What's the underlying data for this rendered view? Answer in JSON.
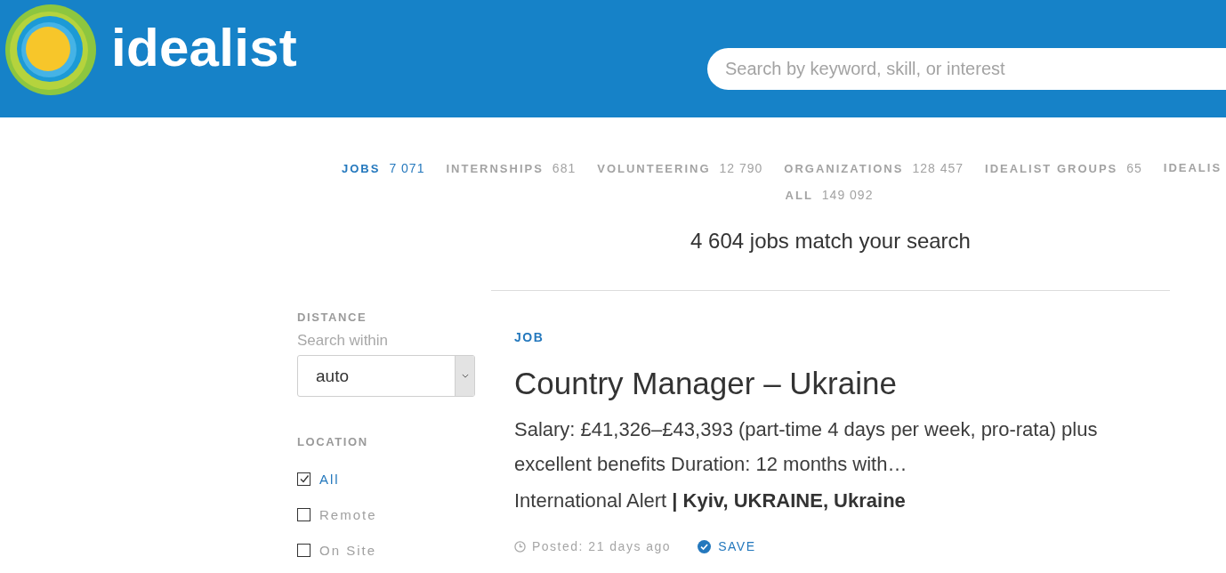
{
  "header": {
    "logo_text": "idealist",
    "search": {
      "placeholder": "Search by keyword, skill, or interest"
    }
  },
  "tabs": [
    {
      "label": "JOBS",
      "count": "7 071",
      "selected": true
    },
    {
      "label": "INTERNSHIPS",
      "count": "681",
      "selected": false
    },
    {
      "label": "VOLUNTEERING",
      "count": "12 790",
      "selected": false
    },
    {
      "label": "ORGANIZATIONS",
      "count": "128 457",
      "selected": false
    },
    {
      "label": "IDEALIST GROUPS",
      "count": "65",
      "selected": false
    },
    {
      "label": "IDEALIS",
      "selected": false
    },
    {
      "label": "ALL",
      "count": "149 092",
      "selected": false
    }
  ],
  "results_summary": "4 604 jobs match your search",
  "filters": {
    "distance": {
      "title": "DISTANCE",
      "hint": "Search within",
      "select": {
        "value": "auto"
      }
    },
    "location": {
      "title": "LOCATION",
      "options": [
        {
          "label": "All",
          "checked": true
        },
        {
          "label": "Remote",
          "checked": false
        },
        {
          "label": "On Site",
          "checked": false
        }
      ]
    }
  },
  "listing": {
    "type_label": "JOB",
    "title": "Country Manager – Ukraine",
    "description": "Salary: £41,326–£43,393 (part-time 4 days per week, pro-rata) plus excellent benefits Duration: 12 months with…",
    "org_location": "International Alert **| Kyiv, UKRAINE, Ukraine**",
    "posted": "Posted: 21 days ago",
    "save_label": "SAVE"
  }
}
